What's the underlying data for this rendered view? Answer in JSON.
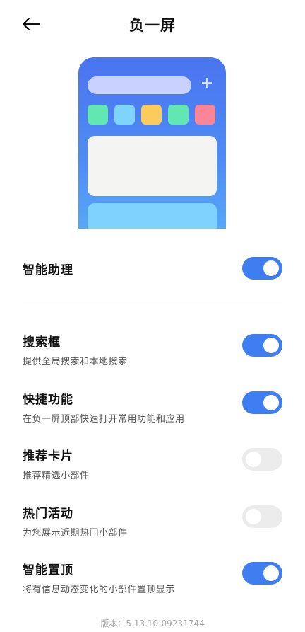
{
  "header": {
    "title": "负一屏",
    "back_icon": "arrow-left-icon"
  },
  "preview": {
    "bg_color": "#4a74f0",
    "plus_symbol": "+",
    "tile_colors": [
      "#62e6b2",
      "#7fd4fd",
      "#fbcc5b",
      "#62e6b2",
      "#f98596"
    ]
  },
  "settings": [
    {
      "title": "智能助理",
      "subtitle": "",
      "enabled": true
    },
    {
      "title": "搜索框",
      "subtitle": "提供全局搜索和本地搜索",
      "enabled": true
    },
    {
      "title": "快捷功能",
      "subtitle": "在负一屏顶部快速打开常用功能和应用",
      "enabled": true
    },
    {
      "title": "推荐卡片",
      "subtitle": "推荐精选小部件",
      "enabled": false
    },
    {
      "title": "热门活动",
      "subtitle": "为您展示近期热门小部件",
      "enabled": false
    },
    {
      "title": "智能置顶",
      "subtitle": "将有信息动态变化的小部件置顶显示",
      "enabled": true
    }
  ],
  "footer": {
    "version": "版本：5.13.10-09231744"
  },
  "colors": {
    "accent": "#3f7ef0",
    "toggle_off": "#ececec"
  }
}
